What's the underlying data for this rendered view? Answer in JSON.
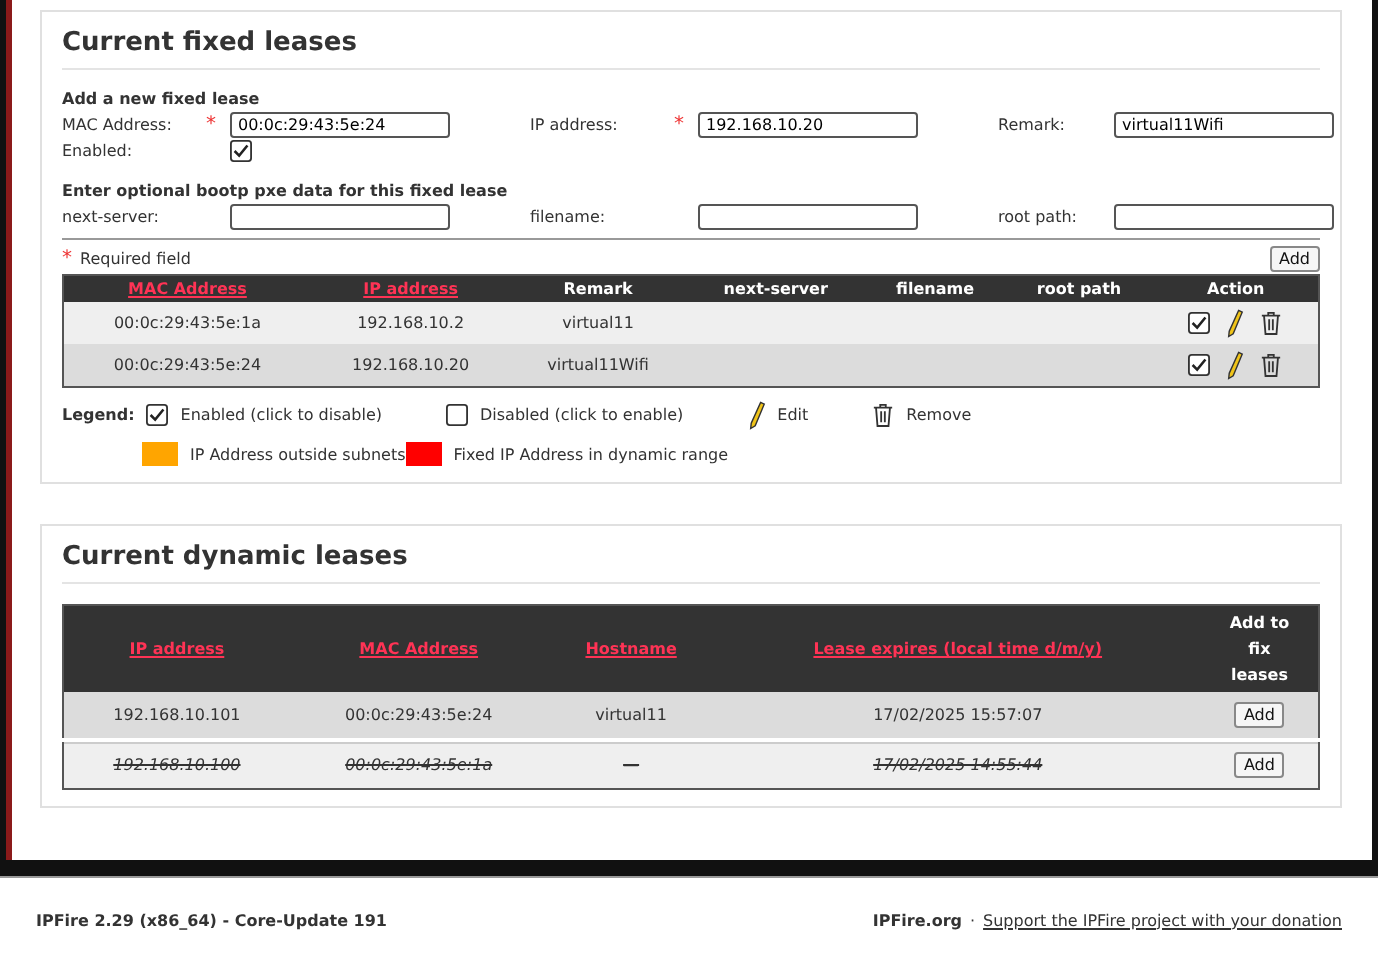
{
  "fixed_leases": {
    "title": "Current fixed leases",
    "form_heading": "Add a new fixed lease",
    "fields": [
      {
        "label": "MAC Address:",
        "required": true,
        "value": "00:0c:29:43:5e:24"
      },
      {
        "label": "IP address:",
        "required": true,
        "value": "192.168.10.20"
      },
      {
        "label": "Remark:",
        "required": false,
        "value": "virtual11Wifi"
      }
    ],
    "enabled": {
      "label": "Enabled:",
      "checked": true
    },
    "pxe_heading": "Enter optional bootp pxe data for this fixed lease",
    "pxe_fields": [
      {
        "label": "next-server:",
        "required": false
      },
      {
        "label": "filename:",
        "required": false
      },
      {
        "label": "root path:",
        "required": false
      }
    ],
    "required_mark": "*",
    "required_note": "Required field",
    "add_button": "Add",
    "columns": [
      {
        "label": "MAC Address",
        "sortable": true
      },
      {
        "label": "IP address",
        "sortable": true
      },
      {
        "label": "Remark",
        "sortable": false
      },
      {
        "label": "next-server",
        "sortable": false
      },
      {
        "label": "filename",
        "sortable": false
      },
      {
        "label": "root path",
        "sortable": false
      },
      {
        "label": "Action",
        "sortable": false
      }
    ],
    "rows": [
      {
        "cells": [
          "00:0c:29:43:5e:1a",
          "192.168.10.2",
          "virtual11"
        ],
        "enabled": true
      },
      {
        "cells": [
          "00:0c:29:43:5e:24",
          "192.168.10.20",
          "virtual11Wifi"
        ],
        "enabled": true
      }
    ],
    "legend_label": "Legend:",
    "legend": [
      {
        "kind": "checkbox",
        "checked": true,
        "text": "Enabled (click to disable)"
      },
      {
        "kind": "checkbox",
        "checked": false,
        "text": "Disabled (click to enable)"
      },
      {
        "kind": "edit",
        "text": "Edit"
      },
      {
        "kind": "remove",
        "text": "Remove"
      }
    ],
    "color_legend": [
      {
        "color": "#ffa500",
        "text": "IP Address outside subnets"
      },
      {
        "color": "#ff0000",
        "text": "Fixed IP Address in dynamic range"
      }
    ]
  },
  "dynamic_leases": {
    "title": "Current dynamic leases",
    "columns": [
      {
        "label": "IP address",
        "sortable": true
      },
      {
        "label": "MAC Address",
        "sortable": true
      },
      {
        "label": "Hostname",
        "sortable": true
      },
      {
        "label": "Lease expires (local time d/m/y)",
        "sortable": true
      },
      {
        "label": "Add to fix leases",
        "sortable": false
      }
    ],
    "rows": [
      {
        "cells": [
          "192.168.10.101",
          "00:0c:29:43:5e:24",
          "virtual11",
          "17/02/2025 15:57:07"
        ],
        "expired": false,
        "button": "Add"
      },
      {
        "cells": [
          "192.168.10.100",
          "00:0c:29:43:5e:1a",
          "—",
          "17/02/2025 14:55:44"
        ],
        "expired": true,
        "button": "Add"
      }
    ]
  },
  "footer": {
    "version": "IPFire 2.29 (x86_64) - Core-Update 191",
    "site": "IPFire.org",
    "separator": "·",
    "link": "Support the IPFire project with your donation"
  }
}
